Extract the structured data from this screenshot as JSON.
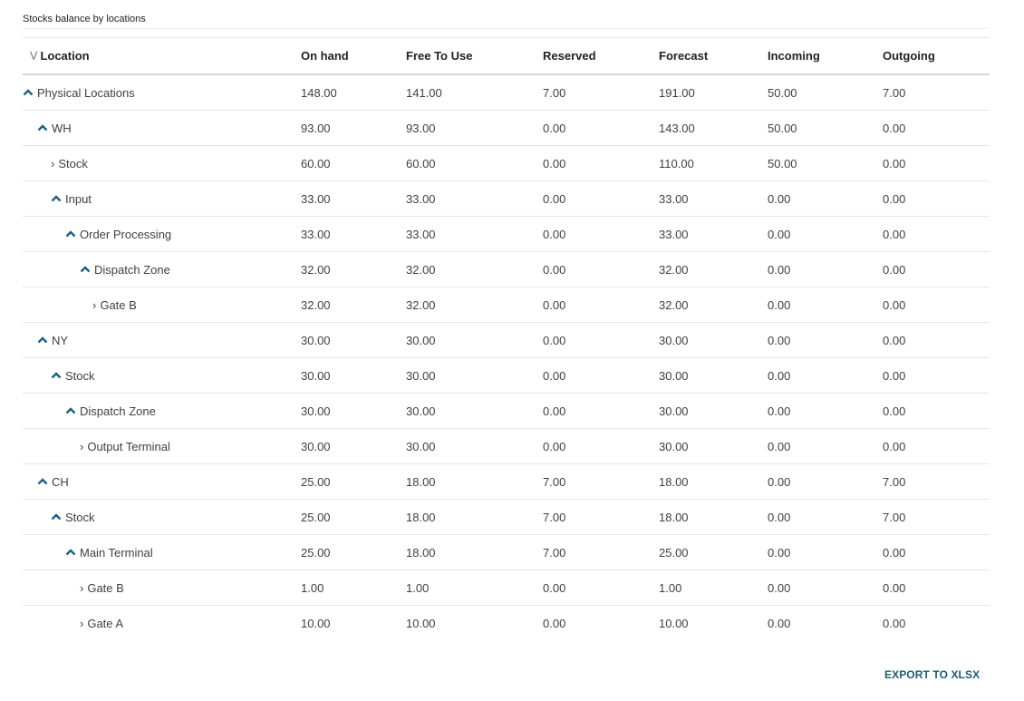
{
  "title": "Stocks balance by locations",
  "table": {
    "columns": [
      "Location",
      "On hand",
      "Free To Use",
      "Reserved",
      "Forecast",
      "Incoming",
      "Outgoing"
    ],
    "rows": [
      {
        "name": "Physical Locations",
        "level": 0,
        "state": "expanded",
        "values": [
          "148.00",
          "141.00",
          "7.00",
          "191.00",
          "50.00",
          "7.00"
        ]
      },
      {
        "name": "WH",
        "level": 1,
        "state": "expanded",
        "values": [
          "93.00",
          "93.00",
          "0.00",
          "143.00",
          "50.00",
          "0.00"
        ]
      },
      {
        "name": "Stock",
        "level": 2,
        "state": "collapsed",
        "values": [
          "60.00",
          "60.00",
          "0.00",
          "110.00",
          "50.00",
          "0.00"
        ]
      },
      {
        "name": "Input",
        "level": 2,
        "state": "expanded",
        "values": [
          "33.00",
          "33.00",
          "0.00",
          "33.00",
          "0.00",
          "0.00"
        ]
      },
      {
        "name": "Order Processing",
        "level": 3,
        "state": "expanded",
        "values": [
          "33.00",
          "33.00",
          "0.00",
          "33.00",
          "0.00",
          "0.00"
        ]
      },
      {
        "name": "Dispatch Zone",
        "level": 4,
        "state": "expanded",
        "values": [
          "32.00",
          "32.00",
          "0.00",
          "32.00",
          "0.00",
          "0.00"
        ]
      },
      {
        "name": "Gate B",
        "level": 5,
        "state": "collapsed",
        "values": [
          "32.00",
          "32.00",
          "0.00",
          "32.00",
          "0.00",
          "0.00"
        ]
      },
      {
        "name": "NY",
        "level": 1,
        "state": "expanded",
        "values": [
          "30.00",
          "30.00",
          "0.00",
          "30.00",
          "0.00",
          "0.00"
        ]
      },
      {
        "name": "Stock",
        "level": 2,
        "state": "expanded",
        "values": [
          "30.00",
          "30.00",
          "0.00",
          "30.00",
          "0.00",
          "0.00"
        ]
      },
      {
        "name": "Dispatch Zone",
        "level": 3,
        "state": "expanded",
        "values": [
          "30.00",
          "30.00",
          "0.00",
          "30.00",
          "0.00",
          "0.00"
        ]
      },
      {
        "name": "Output Terminal",
        "level": 4,
        "state": "collapsed",
        "values": [
          "30.00",
          "30.00",
          "0.00",
          "30.00",
          "0.00",
          "0.00"
        ]
      },
      {
        "name": "CH",
        "level": 1,
        "state": "expanded",
        "values": [
          "25.00",
          "18.00",
          "7.00",
          "18.00",
          "0.00",
          "7.00"
        ]
      },
      {
        "name": "Stock",
        "level": 2,
        "state": "expanded",
        "values": [
          "25.00",
          "18.00",
          "7.00",
          "18.00",
          "0.00",
          "7.00"
        ]
      },
      {
        "name": "Main Terminal",
        "level": 3,
        "state": "expanded",
        "values": [
          "25.00",
          "18.00",
          "7.00",
          "25.00",
          "0.00",
          "0.00"
        ]
      },
      {
        "name": "Gate B",
        "level": 4,
        "state": "collapsed",
        "values": [
          "1.00",
          "1.00",
          "0.00",
          "1.00",
          "0.00",
          "0.00"
        ]
      },
      {
        "name": "Gate A",
        "level": 4,
        "state": "collapsed",
        "values": [
          "10.00",
          "10.00",
          "0.00",
          "10.00",
          "0.00",
          "0.00"
        ]
      }
    ]
  },
  "icons": {
    "sort": "sort-double-chevron-down-icon",
    "expanded": "caret-up-icon",
    "collapsed": "chevron-right-icon"
  },
  "colors": {
    "accent": "#1e5a75",
    "caret": "#1f5f7e"
  },
  "export_label": "EXPORT TO XLSX"
}
